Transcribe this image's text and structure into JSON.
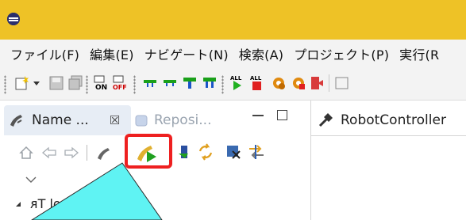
{
  "menu": {
    "items": [
      "ファイル(F)",
      "編集(E)",
      "ナビゲート(N)",
      "検索(A)",
      "プロジェクト(P)",
      "実行(R"
    ]
  },
  "left_panel": {
    "tab_active_label": "Name ...",
    "tab_active_close": "☒",
    "tab_inactive_label": "Reposi...",
    "tree_first_item": "ᴙT lo"
  },
  "right_panel": {
    "tab_label": "RobotController"
  },
  "toolbar_icons": [
    "new-icon",
    "dropdown-icon",
    "save-icon",
    "save-all-icon",
    "on-icon",
    "off-icon",
    "t-icon-1",
    "t-icon-2",
    "t-icon-3",
    "t-icon-4",
    "run-all-icon",
    "stop-all-icon",
    "gear-icon",
    "gear-lock-icon",
    "exit-icon",
    "window-icon"
  ],
  "colors": {
    "titlebar": "#eec226",
    "highlight": "#ee2020",
    "overlay": "#5ff3f3"
  }
}
